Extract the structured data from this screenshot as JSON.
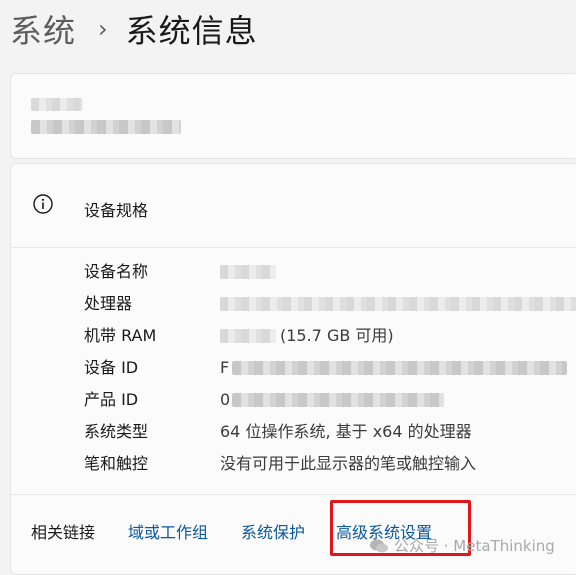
{
  "breadcrumb": {
    "parent": "系统",
    "separator": "›",
    "current": "系统信息"
  },
  "specs": {
    "title": "设备规格",
    "rows": [
      {
        "label": "设备名称",
        "value": ""
      },
      {
        "label": "处理器",
        "value": ""
      },
      {
        "label": "机带 RAM",
        "value": "(15.7 GB 可用)"
      },
      {
        "label": "设备 ID",
        "value": "F"
      },
      {
        "label": "产品 ID",
        "value": "0"
      },
      {
        "label": "系统类型",
        "value": "64 位操作系统, 基于 x64 的处理器"
      },
      {
        "label": "笔和触控",
        "value": "没有可用于此显示器的笔或触控输入"
      }
    ]
  },
  "related_links": {
    "label": "相关链接",
    "items": [
      "域或工作组",
      "系统保护",
      "高级系统设置"
    ]
  },
  "watermark": "公众号 · MetaThinking",
  "colors": {
    "link": "#0b57a0",
    "highlight_box": "#e0161b"
  }
}
